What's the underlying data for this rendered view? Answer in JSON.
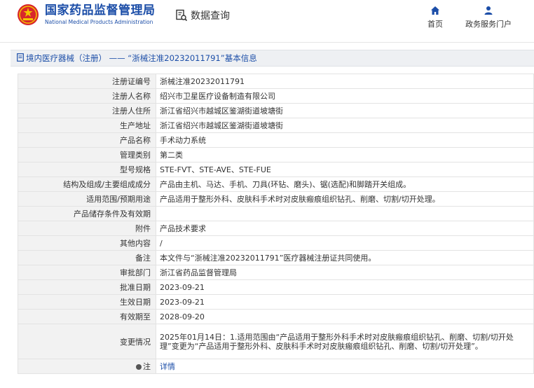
{
  "header": {
    "agency_cn": "国家药品监督管理局",
    "agency_en": "National Medical Products Administration",
    "query": "数据查询",
    "nav_home": "首页",
    "nav_portal": "政务服务门户"
  },
  "page": {
    "title": "境内医疗器械（注册） —— “浙械注准20232011791”基本信息"
  },
  "rows": [
    {
      "label": "注册证编号",
      "value": "浙械注准20232011791"
    },
    {
      "label": "注册人名称",
      "value": "绍兴市卫星医疗设备制造有限公司"
    },
    {
      "label": "注册人住所",
      "value": "浙江省绍兴市越城区鉴湖街道坡塘街"
    },
    {
      "label": "生产地址",
      "value": "浙江省绍兴市越城区鉴湖街道坡塘街"
    },
    {
      "label": "产品名称",
      "value": "手术动力系统"
    },
    {
      "label": "管理类别",
      "value": "第二类"
    },
    {
      "label": "型号规格",
      "value": "STE-FVT、STE-AVE、STE-FUE"
    },
    {
      "label": "结构及组成/主要组成成分",
      "value": "产品由主机、马达、手机、刀具(环钻、磨头)、锯(选配)和脚踏开关组成。"
    },
    {
      "label": "适用范围/预期用途",
      "value": "产品适用于整形外科、皮肤科手术时对皮肤瘢痕组织钻孔、削磨、切割/切开处理。"
    },
    {
      "label": "产品储存条件及有效期",
      "value": ""
    },
    {
      "label": "附件",
      "value": "产品技术要求"
    },
    {
      "label": "其他内容",
      "value": "/"
    },
    {
      "label": "备注",
      "value": "本文件与“浙械注准20232011791”医疗器械注册证共同使用。"
    },
    {
      "label": "审批部门",
      "value": "浙江省药品监督管理局"
    },
    {
      "label": "批准日期",
      "value": "2023-09-21"
    },
    {
      "label": "生效日期",
      "value": "2023-09-21"
    },
    {
      "label": "有效期至",
      "value": "2028-09-20"
    },
    {
      "label": "变更情况",
      "value": "2025年01月14日：1.适用范围由“产品适用于整形外科手术时对皮肤瘢痕组织钻孔、削磨、切割/切开处理”变更为“产品适用于整形外科、皮肤科手术时对皮肤瘢痕组织钻孔、削磨、切割/切开处理”。"
    }
  ],
  "note": {
    "label": "注",
    "link": "详情"
  },
  "colors": {
    "brand_blue": "#1c4ea8",
    "label_bg": "#f2f2f2",
    "title_bg": "#eef0f3"
  }
}
